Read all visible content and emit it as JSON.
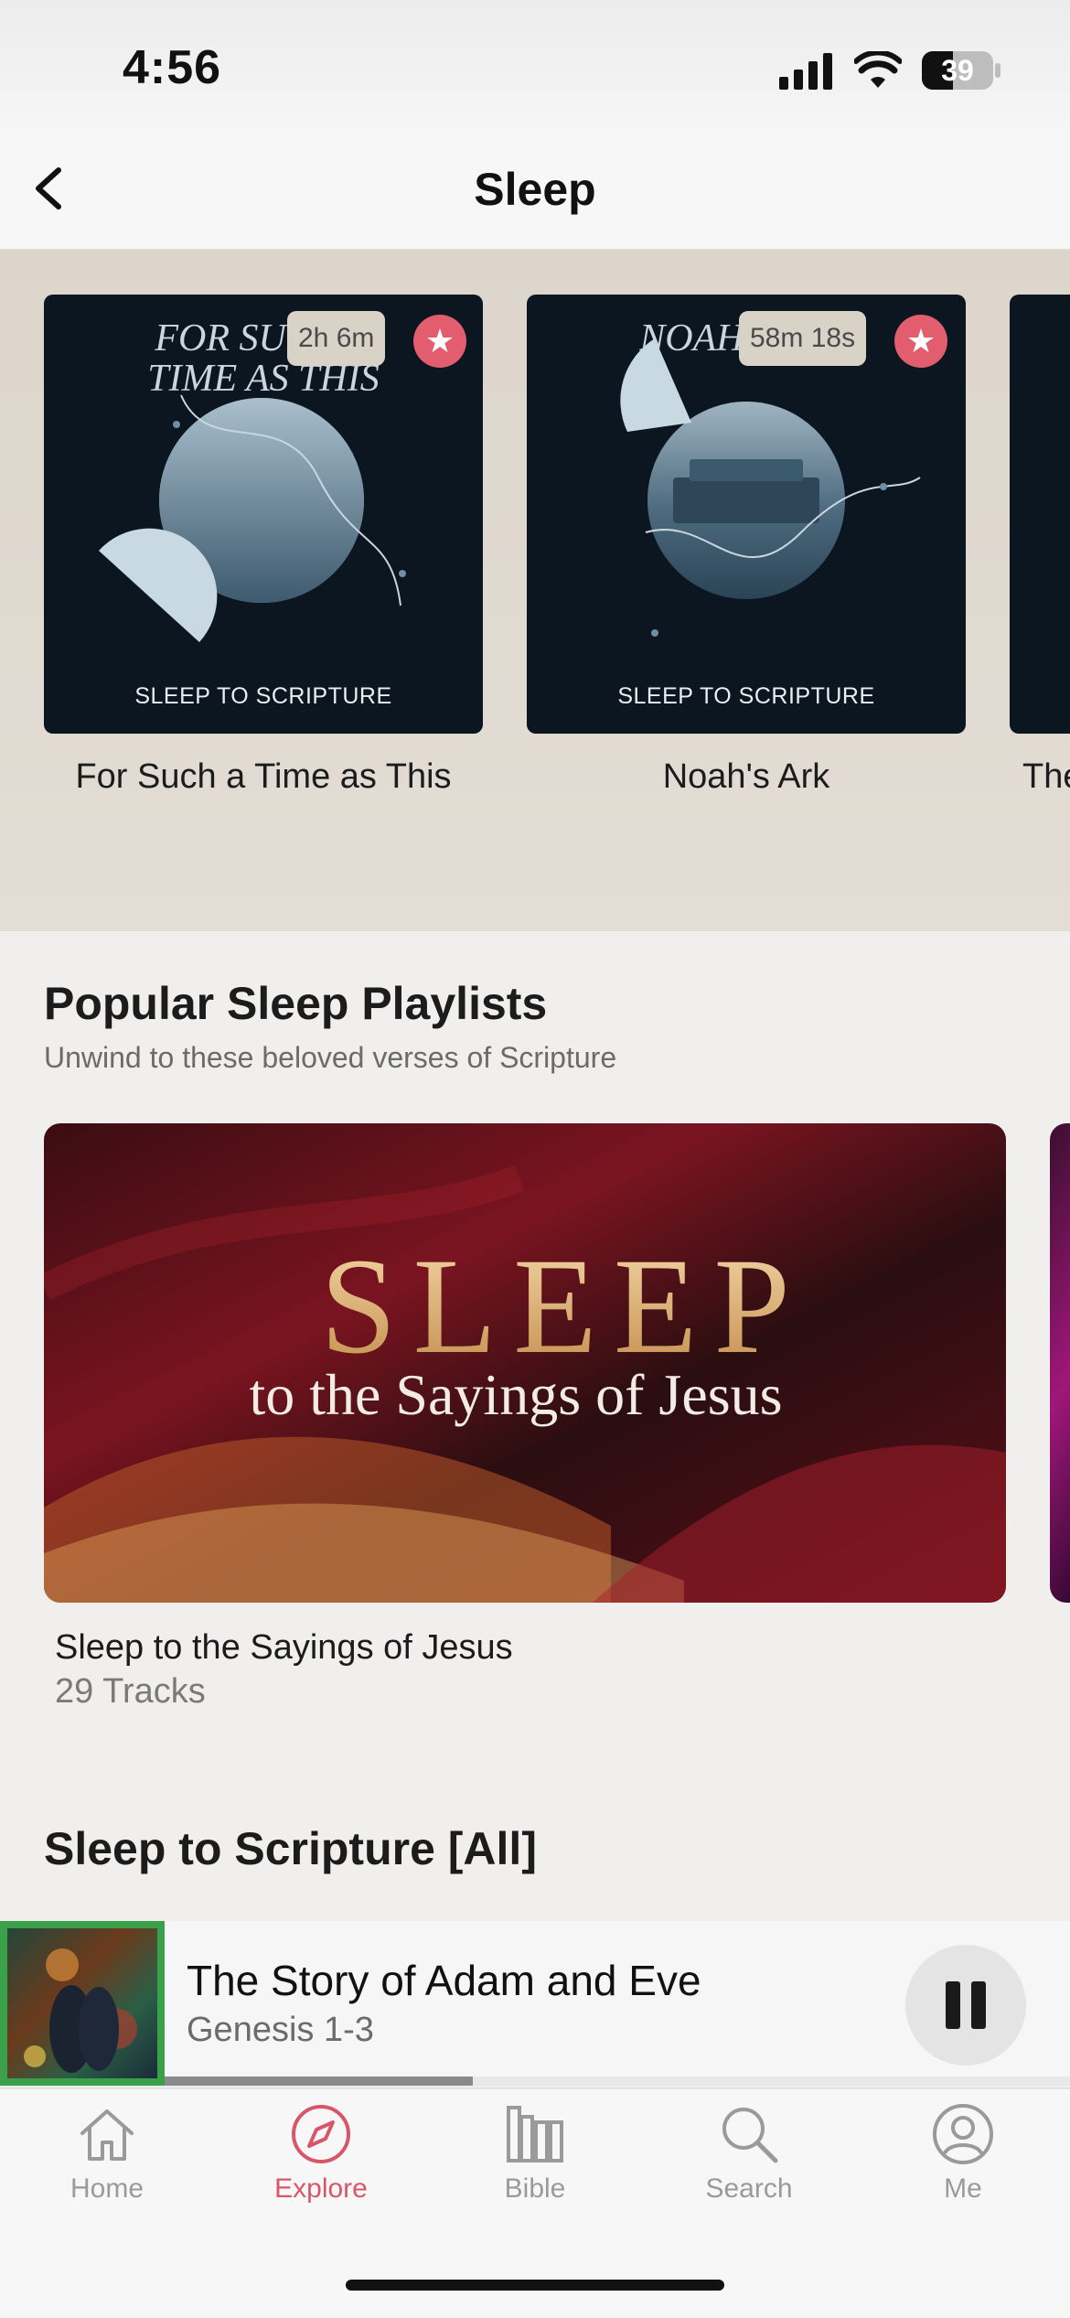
{
  "status_bar": {
    "time": "4:56",
    "battery": "39"
  },
  "header": {
    "title": "Sleep"
  },
  "featured": [
    {
      "art_title": "FOR SUCH A TIME AS THIS",
      "art_subtitle": "SLEEP TO SCRIPTURE",
      "duration": "2h 6m",
      "label": "For Such a Time as This"
    },
    {
      "art_title": "NOAH'S ARK",
      "art_subtitle": "SLEEP TO SCRIPTURE",
      "duration": "58m 18s",
      "label": "Noah's Ark"
    },
    {
      "label": "The"
    }
  ],
  "playlists_section": {
    "title": "Popular Sleep Playlists",
    "subtitle": "Unwind to these beloved verses of Scripture",
    "items": [
      {
        "art_title": "SLEEP",
        "art_subtitle": "to the Sayings of Jesus",
        "name": "Sleep to the Sayings of Jesus",
        "count": "29 Tracks"
      }
    ]
  },
  "next_section": {
    "title": "Sleep to Scripture [All]"
  },
  "now_playing": {
    "title": "The Story of Adam and Eve",
    "subtitle": "Genesis 1-3",
    "progress": 0.34
  },
  "tabs": [
    {
      "label": "Home",
      "icon": "home-icon",
      "active": false
    },
    {
      "label": "Explore",
      "icon": "compass-icon",
      "active": true
    },
    {
      "label": "Bible",
      "icon": "books-icon",
      "active": false
    },
    {
      "label": "Search",
      "icon": "search-icon",
      "active": false
    },
    {
      "label": "Me",
      "icon": "person-icon",
      "active": false
    }
  ],
  "colors": {
    "accent": "#d9566a",
    "star": "#e25d6e",
    "band": "#e0d9d0"
  }
}
